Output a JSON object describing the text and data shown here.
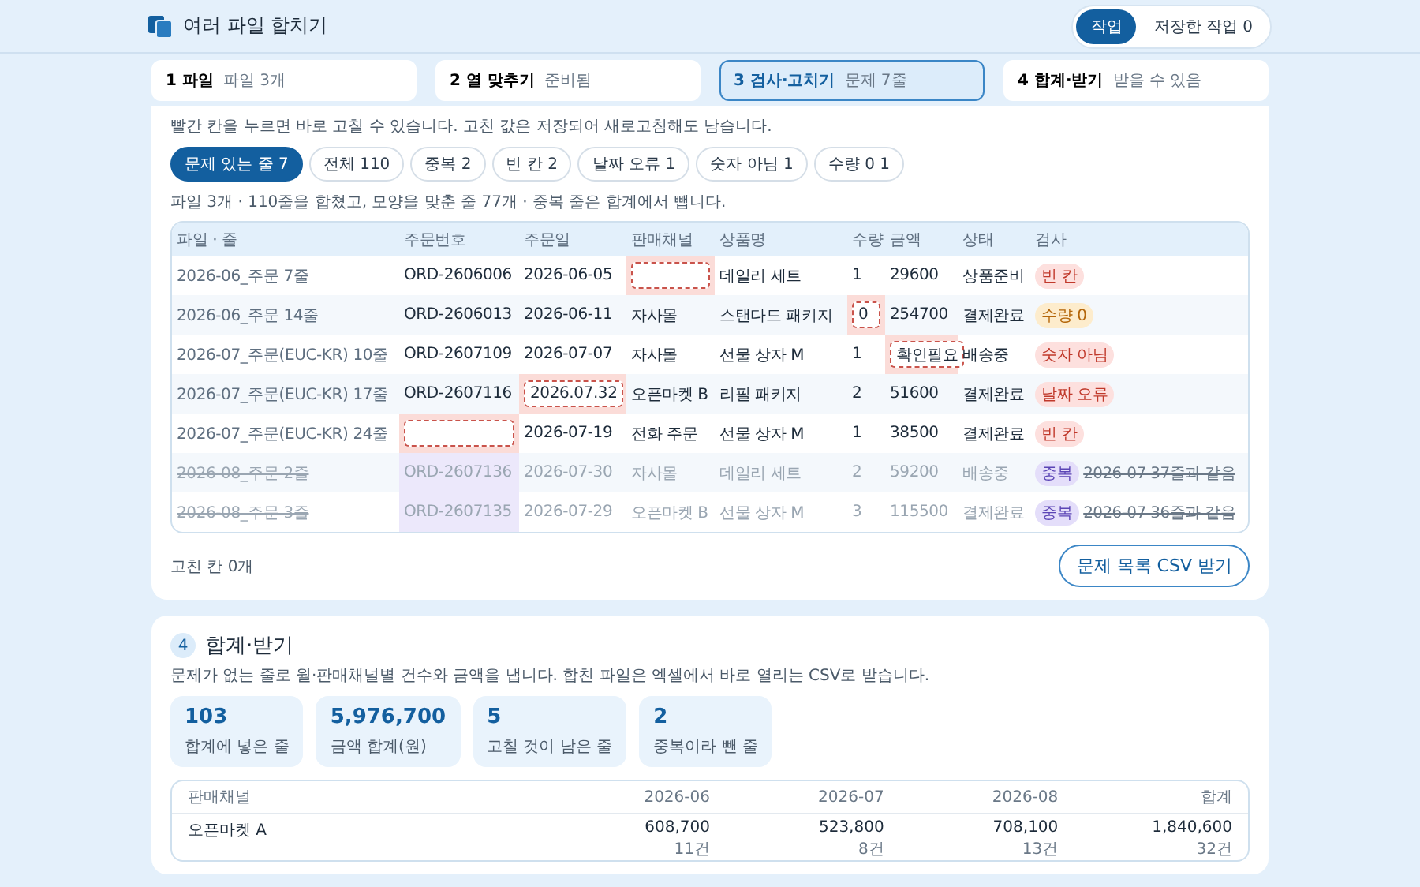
{
  "app": {
    "title": "여러 파일 합치기",
    "tabs": [
      {
        "label": "작업",
        "selected": true
      },
      {
        "label": "저장한 작업 0",
        "selected": false
      }
    ]
  },
  "steps": [
    {
      "title": "1 파일",
      "sub": "파일 3개",
      "selected": false
    },
    {
      "title": "2 열 맞추기",
      "sub": "준비됨",
      "selected": false
    },
    {
      "title": "3 검사·고치기",
      "sub": "문제 7줄",
      "selected": true
    },
    {
      "title": "4 합계·받기",
      "sub": "받을 수 있음",
      "selected": false
    }
  ],
  "check": {
    "description": "빨간 칸을 누르면 바로 고칠 수 있습니다. 고친 값은 저장되어 새로고침해도 남습니다.",
    "filters": [
      {
        "label": "문제 있는 줄 7",
        "selected": true
      },
      {
        "label": "전체 110",
        "selected": false
      },
      {
        "label": "중복 2",
        "selected": false
      },
      {
        "label": "빈 칸 2",
        "selected": false
      },
      {
        "label": "날짜 오류 1",
        "selected": false
      },
      {
        "label": "숫자 아님 1",
        "selected": false
      },
      {
        "label": "수량 0 1",
        "selected": false
      }
    ],
    "summary": "파일 3개 · 110줄을 합쳤고, 모양을 맞춘 줄 77개 · 중복 줄은 합계에서 뺍니다.",
    "columns": [
      "파일 · 줄",
      "주문번호",
      "주문일",
      "판매채널",
      "상품명",
      "수량",
      "금액",
      "상태",
      "검사"
    ],
    "rows": [
      {
        "duplicate": false,
        "cells": [
          {
            "text": "2026-06_주문 7줄",
            "kind": "file"
          },
          {
            "text": "ORD-2606006",
            "kind": "plain"
          },
          {
            "text": "2026-06-05",
            "kind": "plain"
          },
          {
            "kind": "invalid"
          },
          {
            "text": "데일리 세트",
            "kind": "plain"
          },
          {
            "text": "1",
            "kind": "plain"
          },
          {
            "text": "29600",
            "kind": "plain"
          },
          {
            "text": "상품준비",
            "kind": "plain"
          }
        ],
        "check": {
          "label": "빈 칸",
          "kind": "blank"
        }
      },
      {
        "duplicate": false,
        "cells": [
          {
            "text": "2026-06_주문 14줄",
            "kind": "file"
          },
          {
            "text": "ORD-2606013",
            "kind": "plain"
          },
          {
            "text": "2026-06-11",
            "kind": "plain"
          },
          {
            "text": "자사몰",
            "kind": "plain"
          },
          {
            "text": "스탠다드 패키지",
            "kind": "plain"
          },
          {
            "text": "0",
            "kind": "invalid"
          },
          {
            "text": "254700",
            "kind": "plain"
          },
          {
            "text": "결제완료",
            "kind": "plain"
          }
        ],
        "check": {
          "label": "수량 0",
          "kind": "zero"
        }
      },
      {
        "duplicate": false,
        "cells": [
          {
            "text": "2026-07_주문(EUC-KR) 10줄",
            "kind": "file"
          },
          {
            "text": "ORD-2607109",
            "kind": "plain"
          },
          {
            "text": "2026-07-07",
            "kind": "plain"
          },
          {
            "text": "자사몰",
            "kind": "plain"
          },
          {
            "text": "선물 상자 M",
            "kind": "plain"
          },
          {
            "text": "1",
            "kind": "plain"
          },
          {
            "text": "확인필요",
            "kind": "invalid"
          },
          {
            "text": "배송중",
            "kind": "plain"
          }
        ],
        "check": {
          "label": "숫자 아님",
          "kind": "error"
        }
      },
      {
        "duplicate": false,
        "cells": [
          {
            "text": "2026-07_주문(EUC-KR) 17줄",
            "kind": "file"
          },
          {
            "text": "ORD-2607116",
            "kind": "plain"
          },
          {
            "text": "2026.07.32",
            "kind": "invalid"
          },
          {
            "text": "오픈마켓 B",
            "kind": "plain"
          },
          {
            "text": "리필 패키지",
            "kind": "plain"
          },
          {
            "text": "2",
            "kind": "plain"
          },
          {
            "text": "51600",
            "kind": "plain"
          },
          {
            "text": "결제완료",
            "kind": "plain"
          }
        ],
        "check": {
          "label": "날짜 오류",
          "kind": "error"
        }
      },
      {
        "duplicate": false,
        "cells": [
          {
            "text": "2026-07_주문(EUC-KR) 24줄",
            "kind": "file"
          },
          {
            "kind": "invalid"
          },
          {
            "text": "2026-07-19",
            "kind": "plain"
          },
          {
            "text": "전화 주문",
            "kind": "plain"
          },
          {
            "text": "선물 상자 M",
            "kind": "plain"
          },
          {
            "text": "1",
            "kind": "plain"
          },
          {
            "text": "38500",
            "kind": "plain"
          },
          {
            "text": "결제완료",
            "kind": "plain"
          }
        ],
        "check": {
          "label": "빈 칸",
          "kind": "blank"
        }
      },
      {
        "duplicate": true,
        "cells": [
          {
            "text": "2026-08_주문 2줄",
            "kind": "file"
          },
          {
            "text": "ORD-2607136",
            "kind": "duplicate"
          },
          {
            "text": "2026-07-30",
            "kind": "plain"
          },
          {
            "text": "자사몰",
            "kind": "plain"
          },
          {
            "text": "데일리 세트",
            "kind": "plain"
          },
          {
            "text": "2",
            "kind": "plain"
          },
          {
            "text": "59200",
            "kind": "plain"
          },
          {
            "text": "배송중",
            "kind": "plain"
          }
        ],
        "check": {
          "label": "중복",
          "kind": "dup",
          "note": "2026-07 37줄과 같음"
        }
      },
      {
        "duplicate": true,
        "cells": [
          {
            "text": "2026-08_주문 3줄",
            "kind": "file"
          },
          {
            "text": "ORD-2607135",
            "kind": "duplicate"
          },
          {
            "text": "2026-07-29",
            "kind": "plain"
          },
          {
            "text": "오픈마켓 B",
            "kind": "plain"
          },
          {
            "text": "선물 상자 M",
            "kind": "plain"
          },
          {
            "text": "3",
            "kind": "plain"
          },
          {
            "text": "115500",
            "kind": "plain"
          },
          {
            "text": "결제완료",
            "kind": "plain"
          }
        ],
        "check": {
          "label": "중복",
          "kind": "dup",
          "note": "2026-07 36줄과 같음"
        }
      }
    ],
    "fixed": "고친 칸 0개",
    "export_button": "문제 목록 CSV 받기"
  },
  "totals": {
    "number": "4",
    "title": "합계·받기",
    "description": "문제가 없는 줄로 월·판매채널별 건수와 금액을 냅니다. 합친 파일은 엑셀에서 바로 열리는 CSV로 받습니다.",
    "stats": [
      {
        "value": "103",
        "label": "합계에 넣은 줄"
      },
      {
        "value": "5,976,700",
        "label": "금액 합계(원)"
      },
      {
        "value": "5",
        "label": "고칠 것이 남은 줄"
      },
      {
        "value": "2",
        "label": "중복이라 뺀 줄"
      }
    ],
    "columns": [
      "판매채널",
      "2026-06",
      "2026-07",
      "2026-08",
      "합계"
    ],
    "rows": [
      {
        "cells": [
          {
            "text": "오픈마켓 A"
          },
          {
            "amount": "608,700",
            "count": "11건"
          },
          {
            "amount": "523,800",
            "count": "8건"
          },
          {
            "amount": "708,100",
            "count": "13건"
          },
          {
            "amount": "1,840,600",
            "count": "32건"
          }
        ]
      }
    ]
  }
}
